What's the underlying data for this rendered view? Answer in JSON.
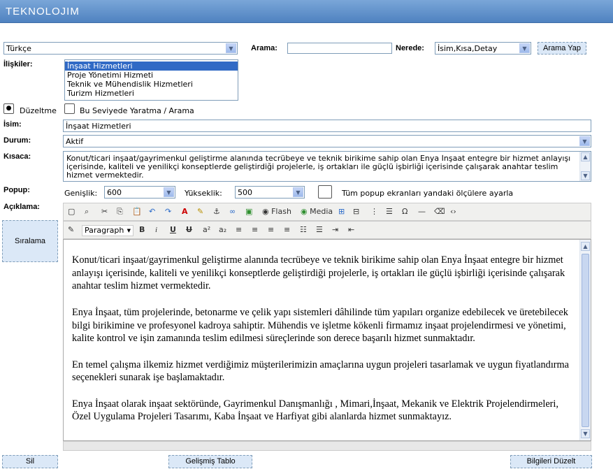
{
  "brand": "TEKNOLOJIM",
  "lang_select": "Türkçe",
  "search": {
    "label": "Arama:",
    "value": "",
    "where_label": "Nerede:",
    "where_value": "İsim,Kısa,Detay",
    "button": "Arama Yap"
  },
  "relations": {
    "label": "İlişkiler:",
    "items": [
      "İnşaat Hizmetleri",
      "Proje Yönetimi Hizmeti",
      "Teknik ve Mühendislik Hizmetleri",
      "Turizm Hizmetleri"
    ]
  },
  "mode": {
    "edit": "Düzeltme",
    "create": "Bu Seviyede Yaratma / Arama"
  },
  "name": {
    "label": "İsim:",
    "value": "İnşaat Hizmetleri"
  },
  "status": {
    "label": "Durum:",
    "value": "Aktif"
  },
  "summary": {
    "label": "Kısaca:",
    "value": "Konut/ticari inşaat/gayrimenkul geliştirme alanında tecrübeye ve teknik birikime sahip olan Enya İnşaat entegre bir hizmet anlayışı içerisinde, kaliteli ve yenilikçi konseptlerde geliştirdiği projelerle, iş ortakları ile güçlü işbirliği içerisinde çalışarak anahtar teslim hizmet vermektedir."
  },
  "popup": {
    "label": "Popup:",
    "width_label": "Genişlik:",
    "width_value": "600",
    "height_label": "Yükseklik:",
    "height_value": "500",
    "apply_all": "Tüm popup ekranları yandaki ölçülere ayarla"
  },
  "description_label": "Açıklama:",
  "sort_button": "Sıralama",
  "toolbar": {
    "flash": "Flash",
    "media": "Media",
    "format": "Paragraph"
  },
  "editor_paragraphs": [
    "Konut/ticari inşaat/gayrimenkul geliştirme alanında tecrübeye ve teknik birikime sahip olan Enya İnşaat entegre bir hizmet anlayışı içerisinde, kaliteli ve yenilikçi konseptlerde geliştirdiği projelerle, iş ortakları ile güçlü işbirliği içerisinde çalışarak anahtar teslim hizmet vermektedir.",
    "Enya İnşaat, tüm projelerinde, betonarme ve çelik yapı sistemleri dâhilinde tüm yapıları organize edebilecek ve üretebilecek bilgi birikimine ve profesyonel kadroya sahiptir. Mühendis ve işletme kökenli firmamız inşaat projelendirmesi ve yönetimi, kalite kontrol ve işin zamanında teslim edilmesi süreçlerinde son derece başarılı hizmet sunmaktadır.",
    "En temel çalışma ilkemiz hizmet verdiğimiz müşterilerimizin amaçlarına uygun projeleri tasarlamak ve uygun fiyatlandırma seçenekleri sunarak işe başlamaktadır.",
    "Enya İnşaat olarak inşaat sektöründe, Gayrimenkul Danışmanlığı , Mimari,İnşaat, Mekanik ve Elektrik Projelendirmeleri, Özel Uygulama Projeleri Tasarımı, Kaba İnşaat ve Harfiyat gibi alanlarda hizmet sunmaktayız."
  ],
  "footer": {
    "delete": "Sil",
    "advanced_table": "Gelişmiş Tablo",
    "update": "Bilgileri Düzelt"
  }
}
